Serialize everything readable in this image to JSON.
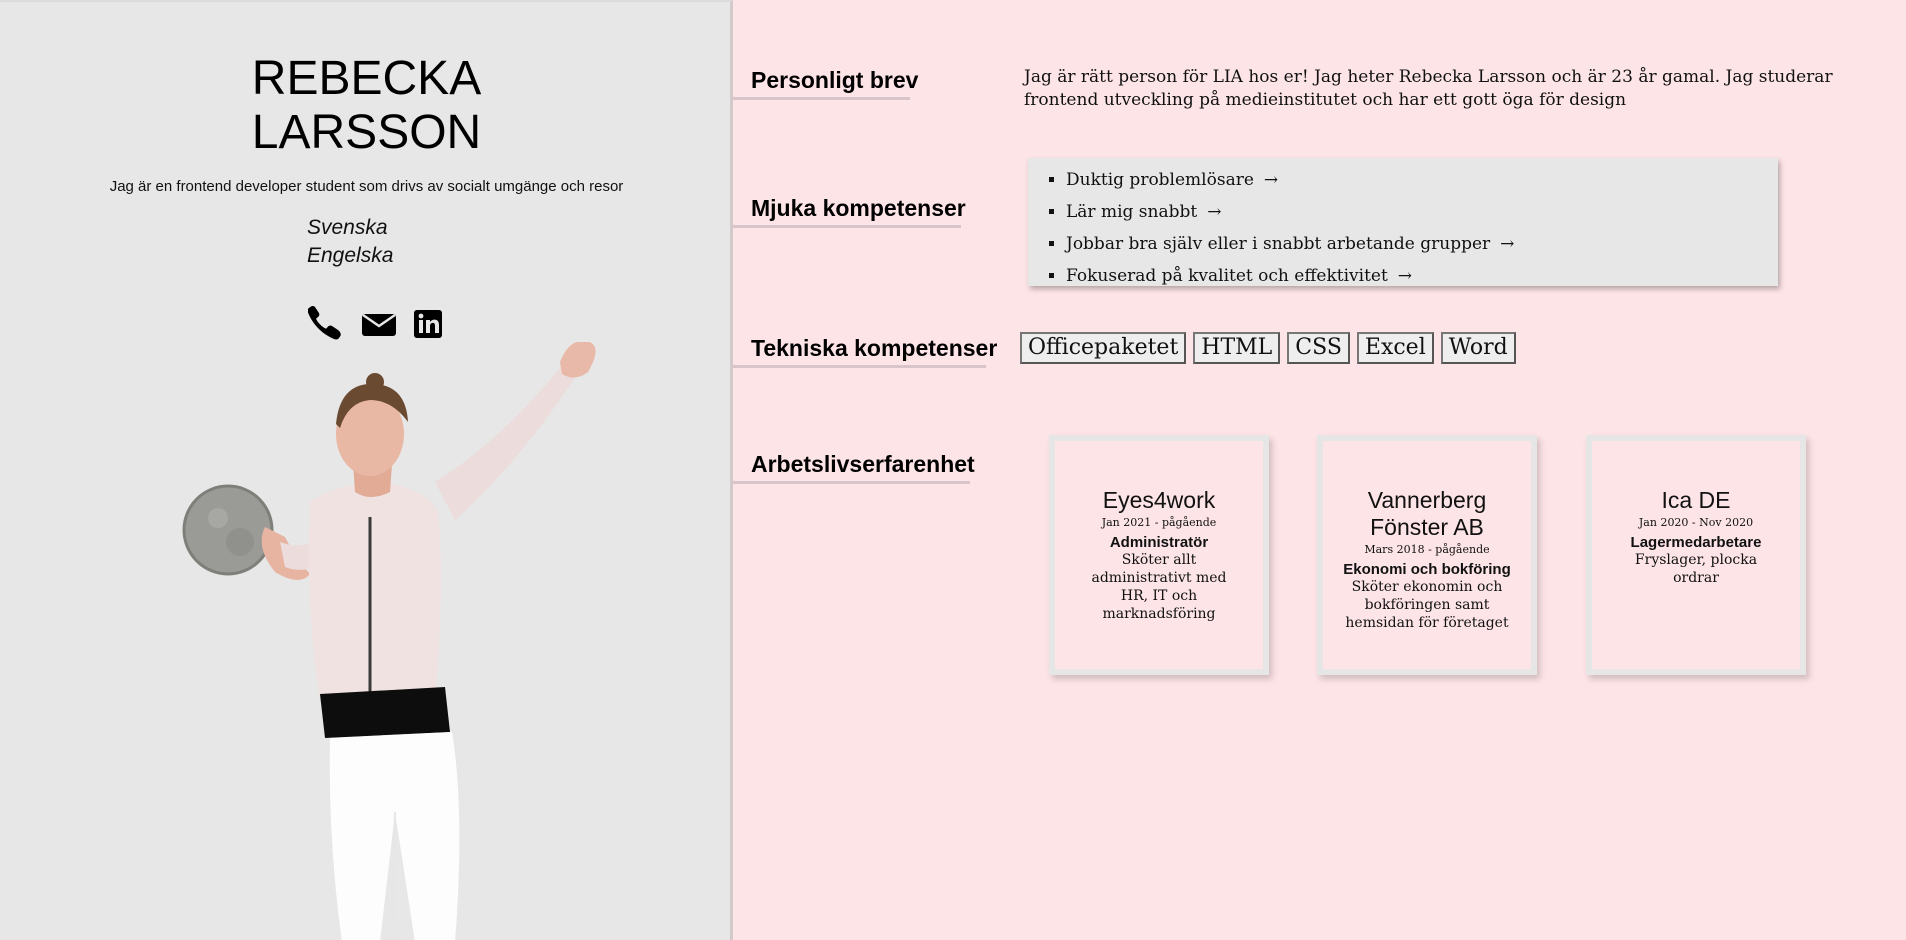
{
  "profile": {
    "name_line1": "REBECKA",
    "name_line2": "LARSSON",
    "tagline": "Jag är en frontend developer student som drivs av socialt umgänge och resor",
    "languages": [
      "Svenska",
      "Engelska"
    ],
    "contacts": [
      {
        "icon": "phone-icon"
      },
      {
        "icon": "envelope-icon"
      },
      {
        "icon": "linkedin-icon"
      }
    ]
  },
  "sections": {
    "letter": {
      "heading": "Personligt brev",
      "text": "Jag är rätt person för LIA hos er! Jag heter Rebecka Larsson och är 23 år gamal. Jag studerar frontend utveckling på medieinstitutet och har ett gott öga för design"
    },
    "soft_skills": {
      "heading": "Mjuka kompetenser",
      "items": [
        "Duktig problemlösare",
        "Lär mig snabbt",
        "Jobbar bra själv eller i snabbt arbetande grupper",
        "Fokuserad på kvalitet och effektivitet"
      ],
      "arrow": "→"
    },
    "tech_skills": {
      "heading": "Tekniska kompetenser",
      "items": [
        "Officepaketet",
        "HTML",
        "CSS",
        "Excel",
        "Word"
      ]
    },
    "experience": {
      "heading": "Arbetslivserfarenhet",
      "jobs": [
        {
          "company": "Eyes4work",
          "period": "Jan 2021 - pågående",
          "role": "Administratör",
          "description": "Sköter allt administrativt med HR, IT och marknadsföring"
        },
        {
          "company": "Vannerberg Fönster AB",
          "period": "Mars 2018 - pågående",
          "role": "Ekonomi och bokföring",
          "description": "Sköter ekonomin och bokföringen samt hemsidan för företaget"
        },
        {
          "company": "Ica DE",
          "period": "Jan 2020 - Nov 2020",
          "role": "Lagermedarbetare",
          "description": "Fryslager, plocka ordrar"
        }
      ]
    }
  },
  "colors": {
    "left_bg": "#e7e7e7",
    "right_bg": "#fde4e7",
    "heading_underline": "#d9c4c9"
  }
}
